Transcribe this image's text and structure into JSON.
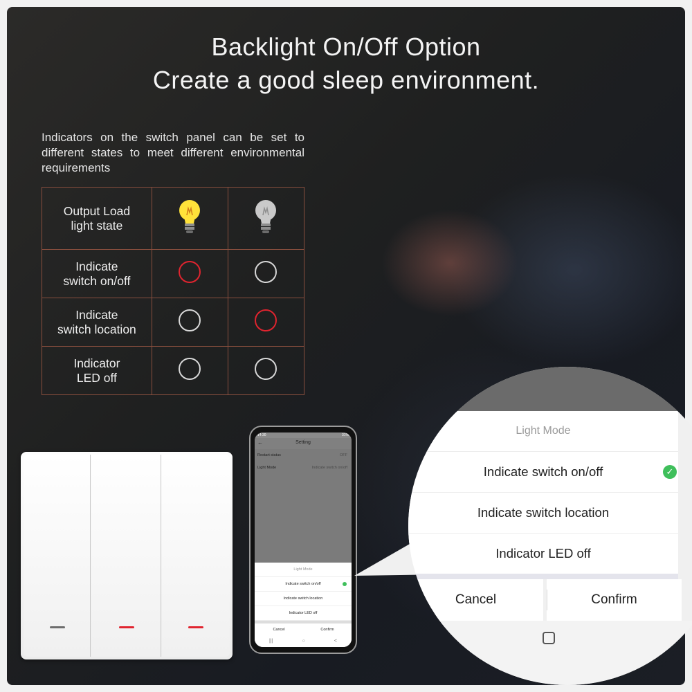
{
  "heading": {
    "line1": "Backlight On/Off Option",
    "line2": "Create a good sleep environment."
  },
  "description": "Indicators on the switch panel can be set to different states to meet different environmental requirements",
  "table": {
    "rows": [
      {
        "label_line1": "Output Load",
        "label_line2": "light state",
        "col1": "bulb-on-icon",
        "col2": "bulb-off-icon"
      },
      {
        "label_line1": "Indicate",
        "label_line2": "switch on/off",
        "col1": "red-ring",
        "col2": "white-ring"
      },
      {
        "label_line1": "Indicate",
        "label_line2": "switch location",
        "col1": "white-ring",
        "col2": "red-ring"
      },
      {
        "label_line1": "Indicator",
        "label_line2": "LED off",
        "col1": "white-ring",
        "col2": "white-ring"
      }
    ],
    "colors": {
      "border": "#8a4f3e",
      "red": "#e0242f",
      "ring": "#d8d8d8"
    }
  },
  "switch_panel": {
    "leds": [
      "white",
      "red",
      "red"
    ]
  },
  "phone": {
    "status_time": "14:30",
    "status_right": "31%",
    "title": "Setting",
    "rows": [
      {
        "label": "Restart status",
        "value": "OFF"
      },
      {
        "label": "Light Mode",
        "value": "Indicate switch on/off"
      }
    ],
    "sheet_title": "Light Mode",
    "options": [
      "Indicate switch on/off",
      "Indicate switch location",
      "Indicator LED off"
    ],
    "cancel": "Cancel",
    "confirm": "Confirm"
  },
  "magnifier": {
    "title": "Light Mode",
    "options": [
      "Indicate switch on/off",
      "Indicate switch location",
      "Indicator LED off"
    ],
    "selected_index": 0,
    "cancel": "Cancel",
    "confirm": "Confirm"
  }
}
